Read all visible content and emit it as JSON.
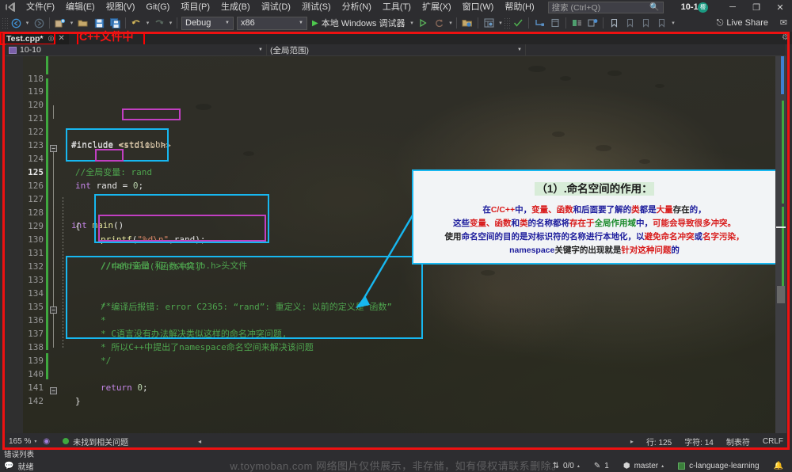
{
  "menu": {
    "logo_icon": "visual-studio-logo-icon",
    "items": [
      "文件(F)",
      "编辑(E)",
      "视图(V)",
      "Git(G)",
      "项目(P)",
      "生成(B)",
      "调试(D)",
      "测试(S)",
      "分析(N)",
      "工具(T)",
      "扩展(X)",
      "窗口(W)",
      "帮助(H)"
    ],
    "search_placeholder": "搜索 (Ctrl+Q)",
    "search_icon": "magnifier-icon",
    "window_title": "10-10",
    "avatar_label": "樱",
    "minimize_icon": "─",
    "maximize_icon": "❐",
    "close_icon": "✕"
  },
  "toolbar": {
    "back_icon": "navigate-back-icon",
    "forward_icon": "navigate-forward-icon",
    "new_project_icon": "new-project-icon",
    "open_icon": "open-folder-icon",
    "save_icon": "save-icon",
    "save_all_icon": "save-all-icon",
    "undo_icon": "undo-icon",
    "redo_icon": "redo-icon",
    "config_value": "Debug",
    "platform_value": "x86",
    "run_label": "本地 Windows 调试器",
    "run_icon": "play-triangle-icon",
    "attach_icon": "attach-process-icon",
    "hotreload_icon": "hot-reload-icon",
    "solution_explorer_icon": "solution-explorer-icon",
    "properties_icon": "properties-window-icon",
    "checkmark_icon": "code-check-icon",
    "step_icon": "step-into-icon",
    "window_icon": "window-icon",
    "indent_icon": "indent-icon",
    "comment_icon": "comment-icon",
    "bookmark_icon": "bookmark-icon",
    "bookmark_prev_icon": "bookmark-previous-icon",
    "bookmark_next_icon": "bookmark-next-icon",
    "bookmark_clear_icon": "bookmark-clear-icon",
    "live_share_label": "Live Share",
    "live_share_icon": "live-share-icon",
    "feedback_icon": "send-feedback-icon"
  },
  "tabs": {
    "active_tab": "Test.cpp*",
    "pin_icon": "pin-icon",
    "close_icon": "✕",
    "annotation": "C++文件中",
    "settings_icon": "gear-icon"
  },
  "navbar": {
    "project_scope": "10-10",
    "member_scope": "(全局范围)",
    "project_icon": "project-icon",
    "dropdown_icon": "chevron-down-icon"
  },
  "editor": {
    "lines": [
      {
        "num": "118",
        "text": ""
      },
      {
        "num": "119",
        "text": ""
      },
      {
        "num": "120",
        "text": ""
      },
      {
        "num": "121",
        "text": "#include <stdio.h>"
      },
      {
        "num": "122",
        "text": "#include <stdlib.h>"
      },
      {
        "num": "123",
        "text": ""
      },
      {
        "num": "124",
        "text": "//全局变量: rand"
      },
      {
        "num": "125",
        "text": "int rand = 0;"
      },
      {
        "num": "126",
        "text": ""
      },
      {
        "num": "127",
        "text": "int main()"
      },
      {
        "num": "128",
        "text": "{"
      },
      {
        "num": "129",
        "text": "    printf(\"%d\\n\",rand);"
      },
      {
        "num": "130",
        "text": "    //rand变量 和 <stdlib.h>头文件"
      },
      {
        "num": "131",
        "text": "    //中的rand()函数冲突了"
      },
      {
        "num": "132",
        "text": ""
      },
      {
        "num": "133",
        "text": "    /*"
      },
      {
        "num": "134",
        "text": "    * 编译后报错: error C2365: “rand”: 重定义: 以前的定义是“函数”"
      },
      {
        "num": "135",
        "text": "    *"
      },
      {
        "num": "136",
        "text": "    * C语言没有办法解决类似这样的命名冲突问题,"
      },
      {
        "num": "137",
        "text": "    * 所以C++中提出了namespace命名空间来解决该问题"
      },
      {
        "num": "138",
        "text": "    */"
      },
      {
        "num": "139",
        "text": ""
      },
      {
        "num": "140",
        "text": "    return 0;"
      },
      {
        "num": "141",
        "text": "}"
      },
      {
        "num": "142",
        "text": ""
      }
    ],
    "current_line": "125",
    "fold_icon": "fold-collapse-icon"
  },
  "callout": {
    "title": "（1）.命名空间的作用：",
    "line1_parts": [
      {
        "t": "在",
        "c": "b"
      },
      {
        "t": "C/C++",
        "c": "r"
      },
      {
        "t": "中，",
        "c": "b"
      },
      {
        "t": "变量、函数",
        "c": "r"
      },
      {
        "t": "和后面要了解的",
        "c": "b"
      },
      {
        "t": "类",
        "c": "r"
      },
      {
        "t": "都是",
        "c": "b"
      },
      {
        "t": "大量",
        "c": "r"
      },
      {
        "t": "存在",
        "c": "k"
      },
      {
        "t": "的，",
        "c": "b"
      }
    ],
    "line2_parts": [
      {
        "t": "这些",
        "c": "b"
      },
      {
        "t": "变量、函数",
        "c": "r"
      },
      {
        "t": "和",
        "c": "b"
      },
      {
        "t": "类",
        "c": "r"
      },
      {
        "t": "的名称都将",
        "c": "b"
      },
      {
        "t": "存在于",
        "c": "r"
      },
      {
        "t": "全局作用域",
        "c": "g"
      },
      {
        "t": "中，",
        "c": "b"
      },
      {
        "t": "可能会导致很多冲突。",
        "c": "r"
      }
    ],
    "line3_parts": [
      {
        "t": "使用",
        "c": "k"
      },
      {
        "t": "命名空间",
        "c": "b"
      },
      {
        "t": "的目的是对标识符的名称进行本地化，以",
        "c": "b"
      },
      {
        "t": "避免命名冲突",
        "c": "r"
      },
      {
        "t": "或",
        "c": "b"
      },
      {
        "t": "名字污染，",
        "c": "r"
      }
    ],
    "line4_parts": [
      {
        "t": "namespace",
        "c": "b"
      },
      {
        "t": "关键字的出现就是",
        "c": "k"
      },
      {
        "t": "针对这种问题",
        "c": "r"
      },
      {
        "t": "的",
        "c": "b"
      }
    ]
  },
  "editor_status": {
    "zoom": "165 %",
    "zoom_caret": "▾",
    "pointer_icon": "screen-reader-icon",
    "issues": "未找到相关问题",
    "issue_status_icon": "ok-circle-icon",
    "nav_arrow": "◂",
    "nav_arrow_right": "▸",
    "line_info": "行: 125",
    "char_info": "字符: 14",
    "tab_info": "制表符",
    "eol_info": "CRLF"
  },
  "error_list": {
    "label": "错误列表"
  },
  "statusbar": {
    "ready": "就绪",
    "ready_icon": "speech-bubble-icon",
    "sync": "0/0",
    "sync_icon": "up-down-arrows-icon",
    "sync_caret": "▴",
    "changes": "1",
    "changes_icon": "pencil-icon",
    "branch": "master",
    "branch_icon": "branch-icon",
    "branch_caret": "▴",
    "repo": "c-language-learning",
    "repo_icon": "repository-icon",
    "notify_icon": "bell-icon"
  },
  "watermark": "w.toymoban.com 网络图片仅供展示，非存储，如有侵权请联系删除。",
  "colors": {
    "accent_red": "#ee1111",
    "accent_cyan": "#17b7f0",
    "accent_magenta": "#c13fc1",
    "chrome": "#2d2d30",
    "editor_bg": "#272822",
    "comment_green": "#4ea44e",
    "keyword_purple": "#c586e8"
  }
}
